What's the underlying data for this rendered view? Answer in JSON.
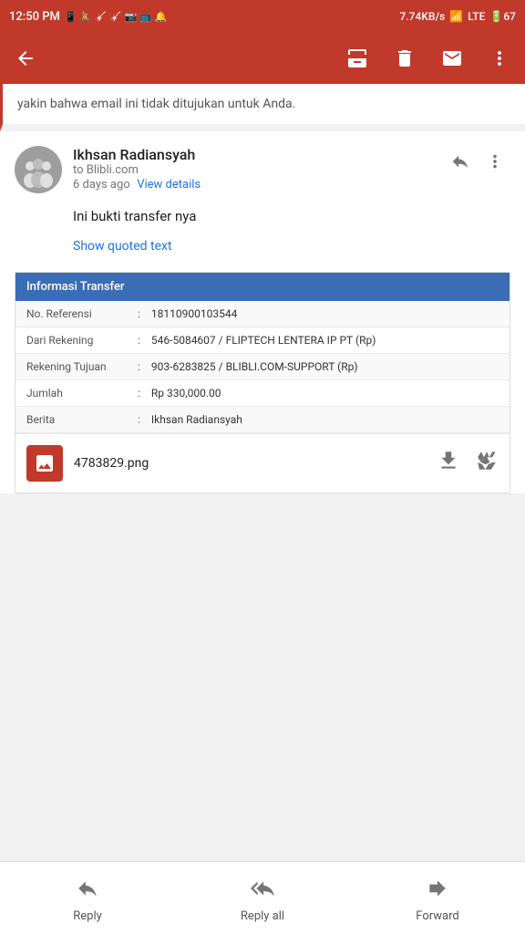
{
  "statusBar": {
    "time": "12:50 PM",
    "speed": "7.74KB/s",
    "signal": "LTE",
    "battery": "67"
  },
  "appBar": {
    "backLabel": "←",
    "archiveLabel": "archive",
    "deleteLabel": "delete",
    "markUnreadLabel": "mark unread",
    "moreLabel": "more"
  },
  "quotedTop": {
    "text": "yakin bahwa email ini tidak ditujukan untuk Anda."
  },
  "email": {
    "senderName": "Ikhsan Radiansyah",
    "to": "to Blibli.com",
    "timeAgo": "6 days ago",
    "viewDetailsLabel": "View details",
    "bodyText": "Ini bukti transfer nya",
    "showQuotedLabel": "Show quoted text"
  },
  "transferTable": {
    "title": "Informasi Transfer",
    "rows": [
      {
        "label": "No. Referensi",
        "value": "18110900103544"
      },
      {
        "label": "Dari Rekening",
        "value": "546-5084607 / FLIPTECH LENTERA IP PT (Rp)"
      },
      {
        "label": "Rekening Tujuan",
        "value": "903-6283825 / BLIBLI.COM-SUPPORT (Rp)"
      },
      {
        "label": "Jumlah",
        "value": "Rp 330,000.00"
      },
      {
        "label": "Berita",
        "value": "Ikhsan Radiansyah"
      }
    ]
  },
  "attachment": {
    "filename": "4783829.png",
    "downloadLabel": "download",
    "driveLabel": "save to drive"
  },
  "bottomBar": {
    "replyLabel": "Reply",
    "replyAllLabel": "Reply all",
    "forwardLabel": "Forward"
  }
}
